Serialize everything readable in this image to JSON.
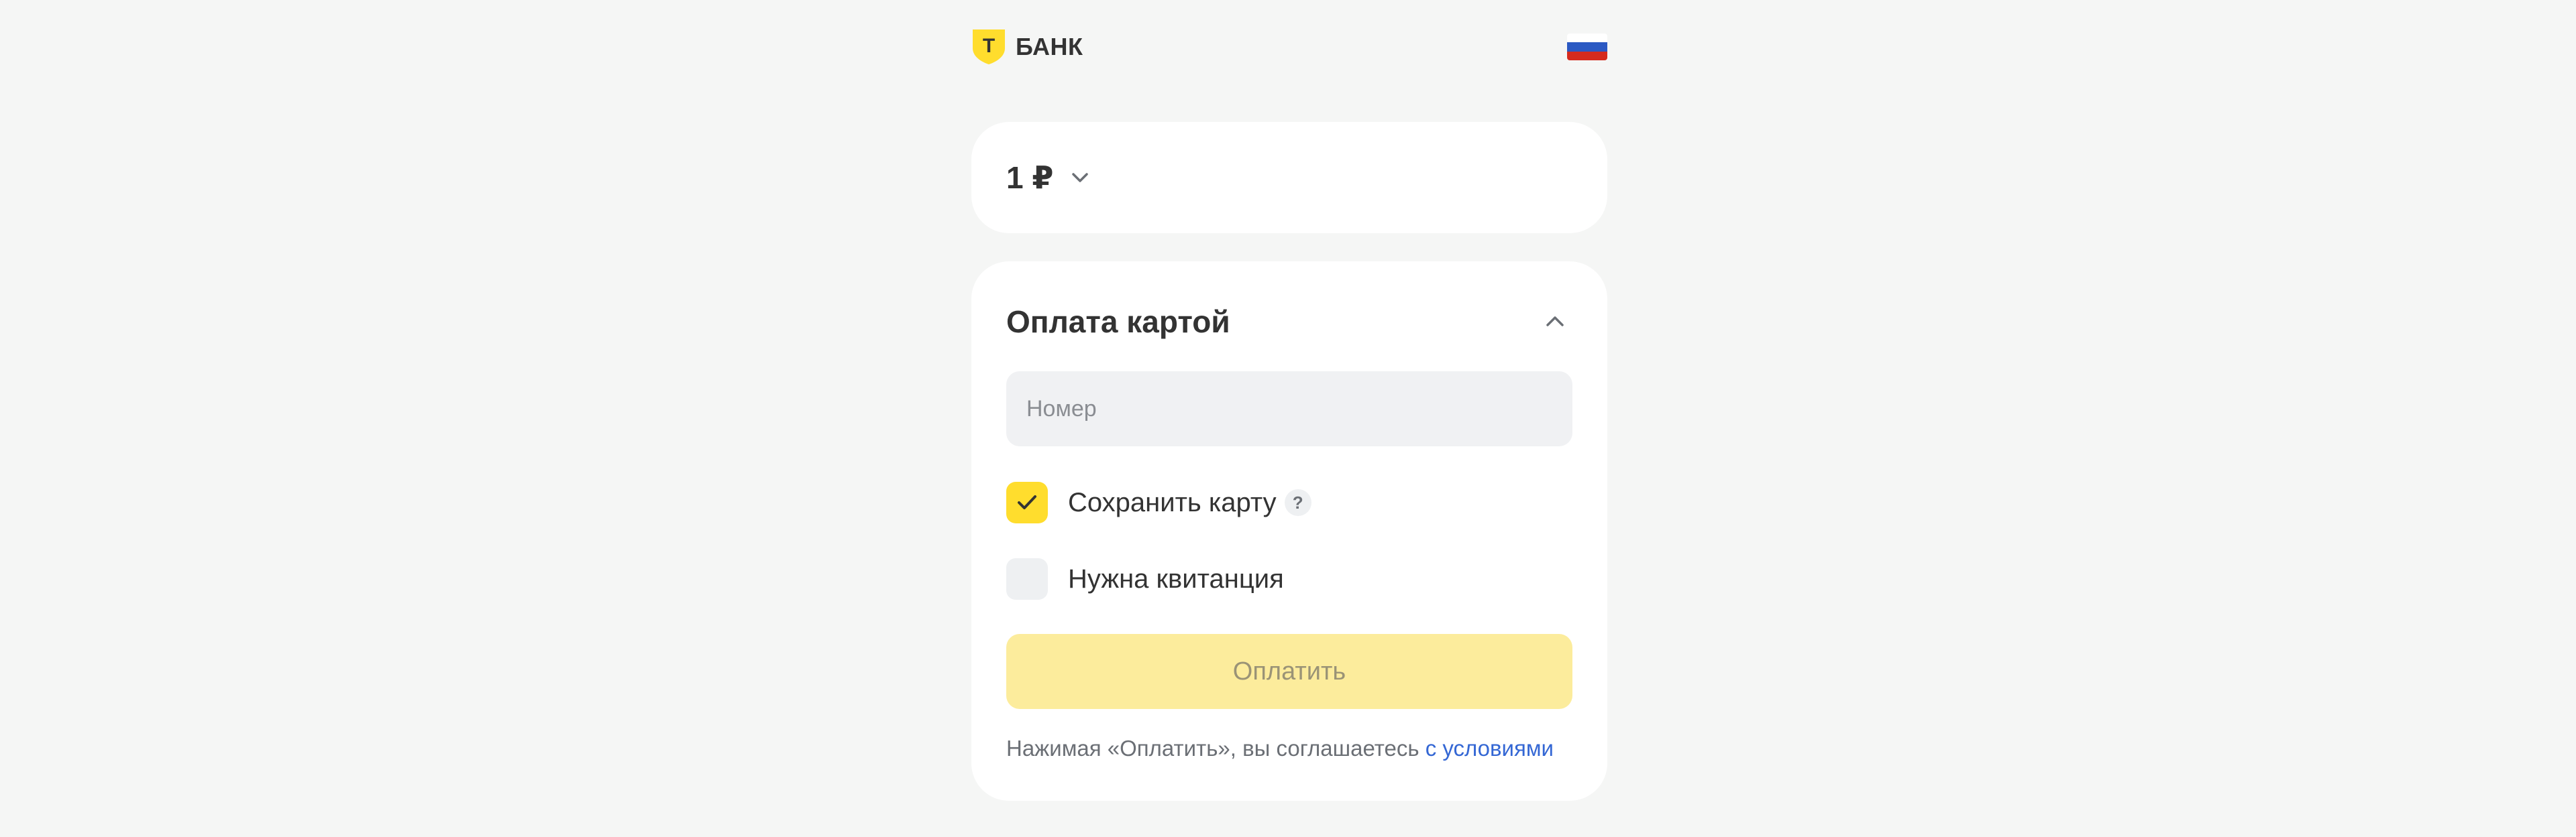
{
  "header": {
    "logo_letter": "Т",
    "logo_text": "БАНК",
    "logo_icon": "tbank-shield-icon",
    "language_flag": "russia-flag-icon",
    "flag_colors": [
      "#ffffff",
      "#2b59c3",
      "#d52b1e"
    ]
  },
  "amount": {
    "value": "1 ₽",
    "chevron_icon": "chevron-down-icon"
  },
  "payment": {
    "title": "Оплата картой",
    "collapse_icon": "chevron-up-icon",
    "card_number": {
      "value": "",
      "placeholder": "Номер"
    },
    "save_card": {
      "label": "Сохранить карту",
      "checked": true,
      "help": "?"
    },
    "receipt": {
      "label": "Нужна квитанция",
      "checked": false
    },
    "pay_button_label": "Оплатить",
    "terms_text": "Нажимая «Оплатить», вы соглашаетесь ",
    "terms_link": "с условиями"
  },
  "colors": {
    "background": "#f5f6f5",
    "card": "#ffffff",
    "accent_yellow": "#ffdd2d",
    "button_disabled": "#fcec9c",
    "link": "#3467d4"
  }
}
